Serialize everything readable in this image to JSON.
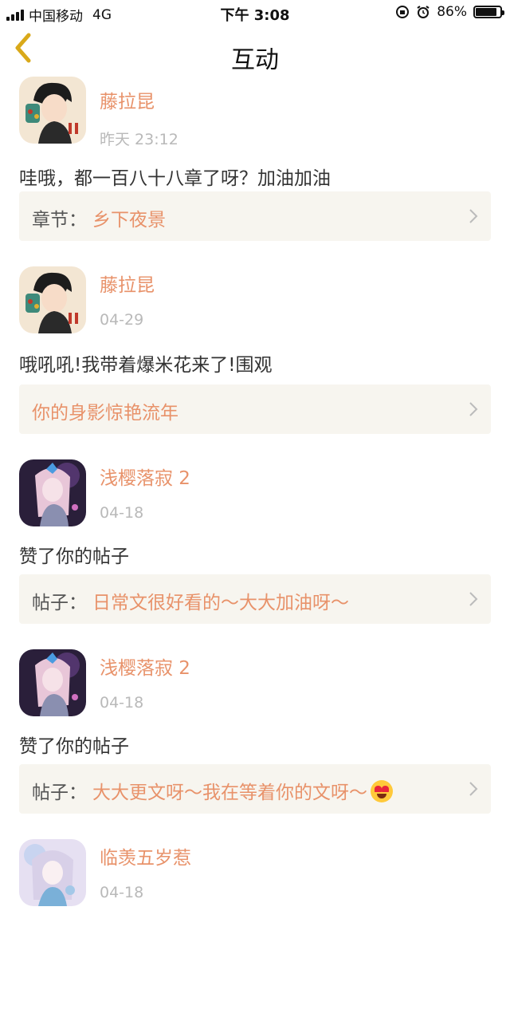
{
  "status_bar": {
    "carrier": "中国移动",
    "network": "4G",
    "time": "下午 3:08",
    "battery": "86%",
    "battery_level": 0.86
  },
  "header": {
    "title": "互动",
    "back_icon": "chevron-left-icon"
  },
  "colors": {
    "accent": "#e8926a",
    "time_gray": "#b9b9b9",
    "ref_bg": "#f7f5ef"
  },
  "items": [
    {
      "name": "藤拉昆",
      "time": "昨天 23:12",
      "content": "哇哦，都一百八十八章了呀？加油加油",
      "ref_label": "章节：",
      "ref_value": "乡下夜景"
    },
    {
      "name": "藤拉昆",
      "time": "04-29",
      "content": "哦吼吼!我带着爆米花来了!围观",
      "ref_label": "",
      "ref_value": "你的身影惊艳流年"
    },
    {
      "name": "浅樱落寂 2",
      "time": "04-18",
      "content": "赞了你的帖子",
      "ref_label": "帖子：",
      "ref_value": "日常文很好看的～大大加油呀～"
    },
    {
      "name": "浅樱落寂 2",
      "time": "04-18",
      "content": "赞了你的帖子",
      "ref_label": "帖子：",
      "ref_value": "大大更文呀～我在等着你的文呀～",
      "ref_emoji": "heart-eyes-emoji-icon"
    },
    {
      "name": "临羡五岁惹",
      "time": "04-18"
    }
  ]
}
